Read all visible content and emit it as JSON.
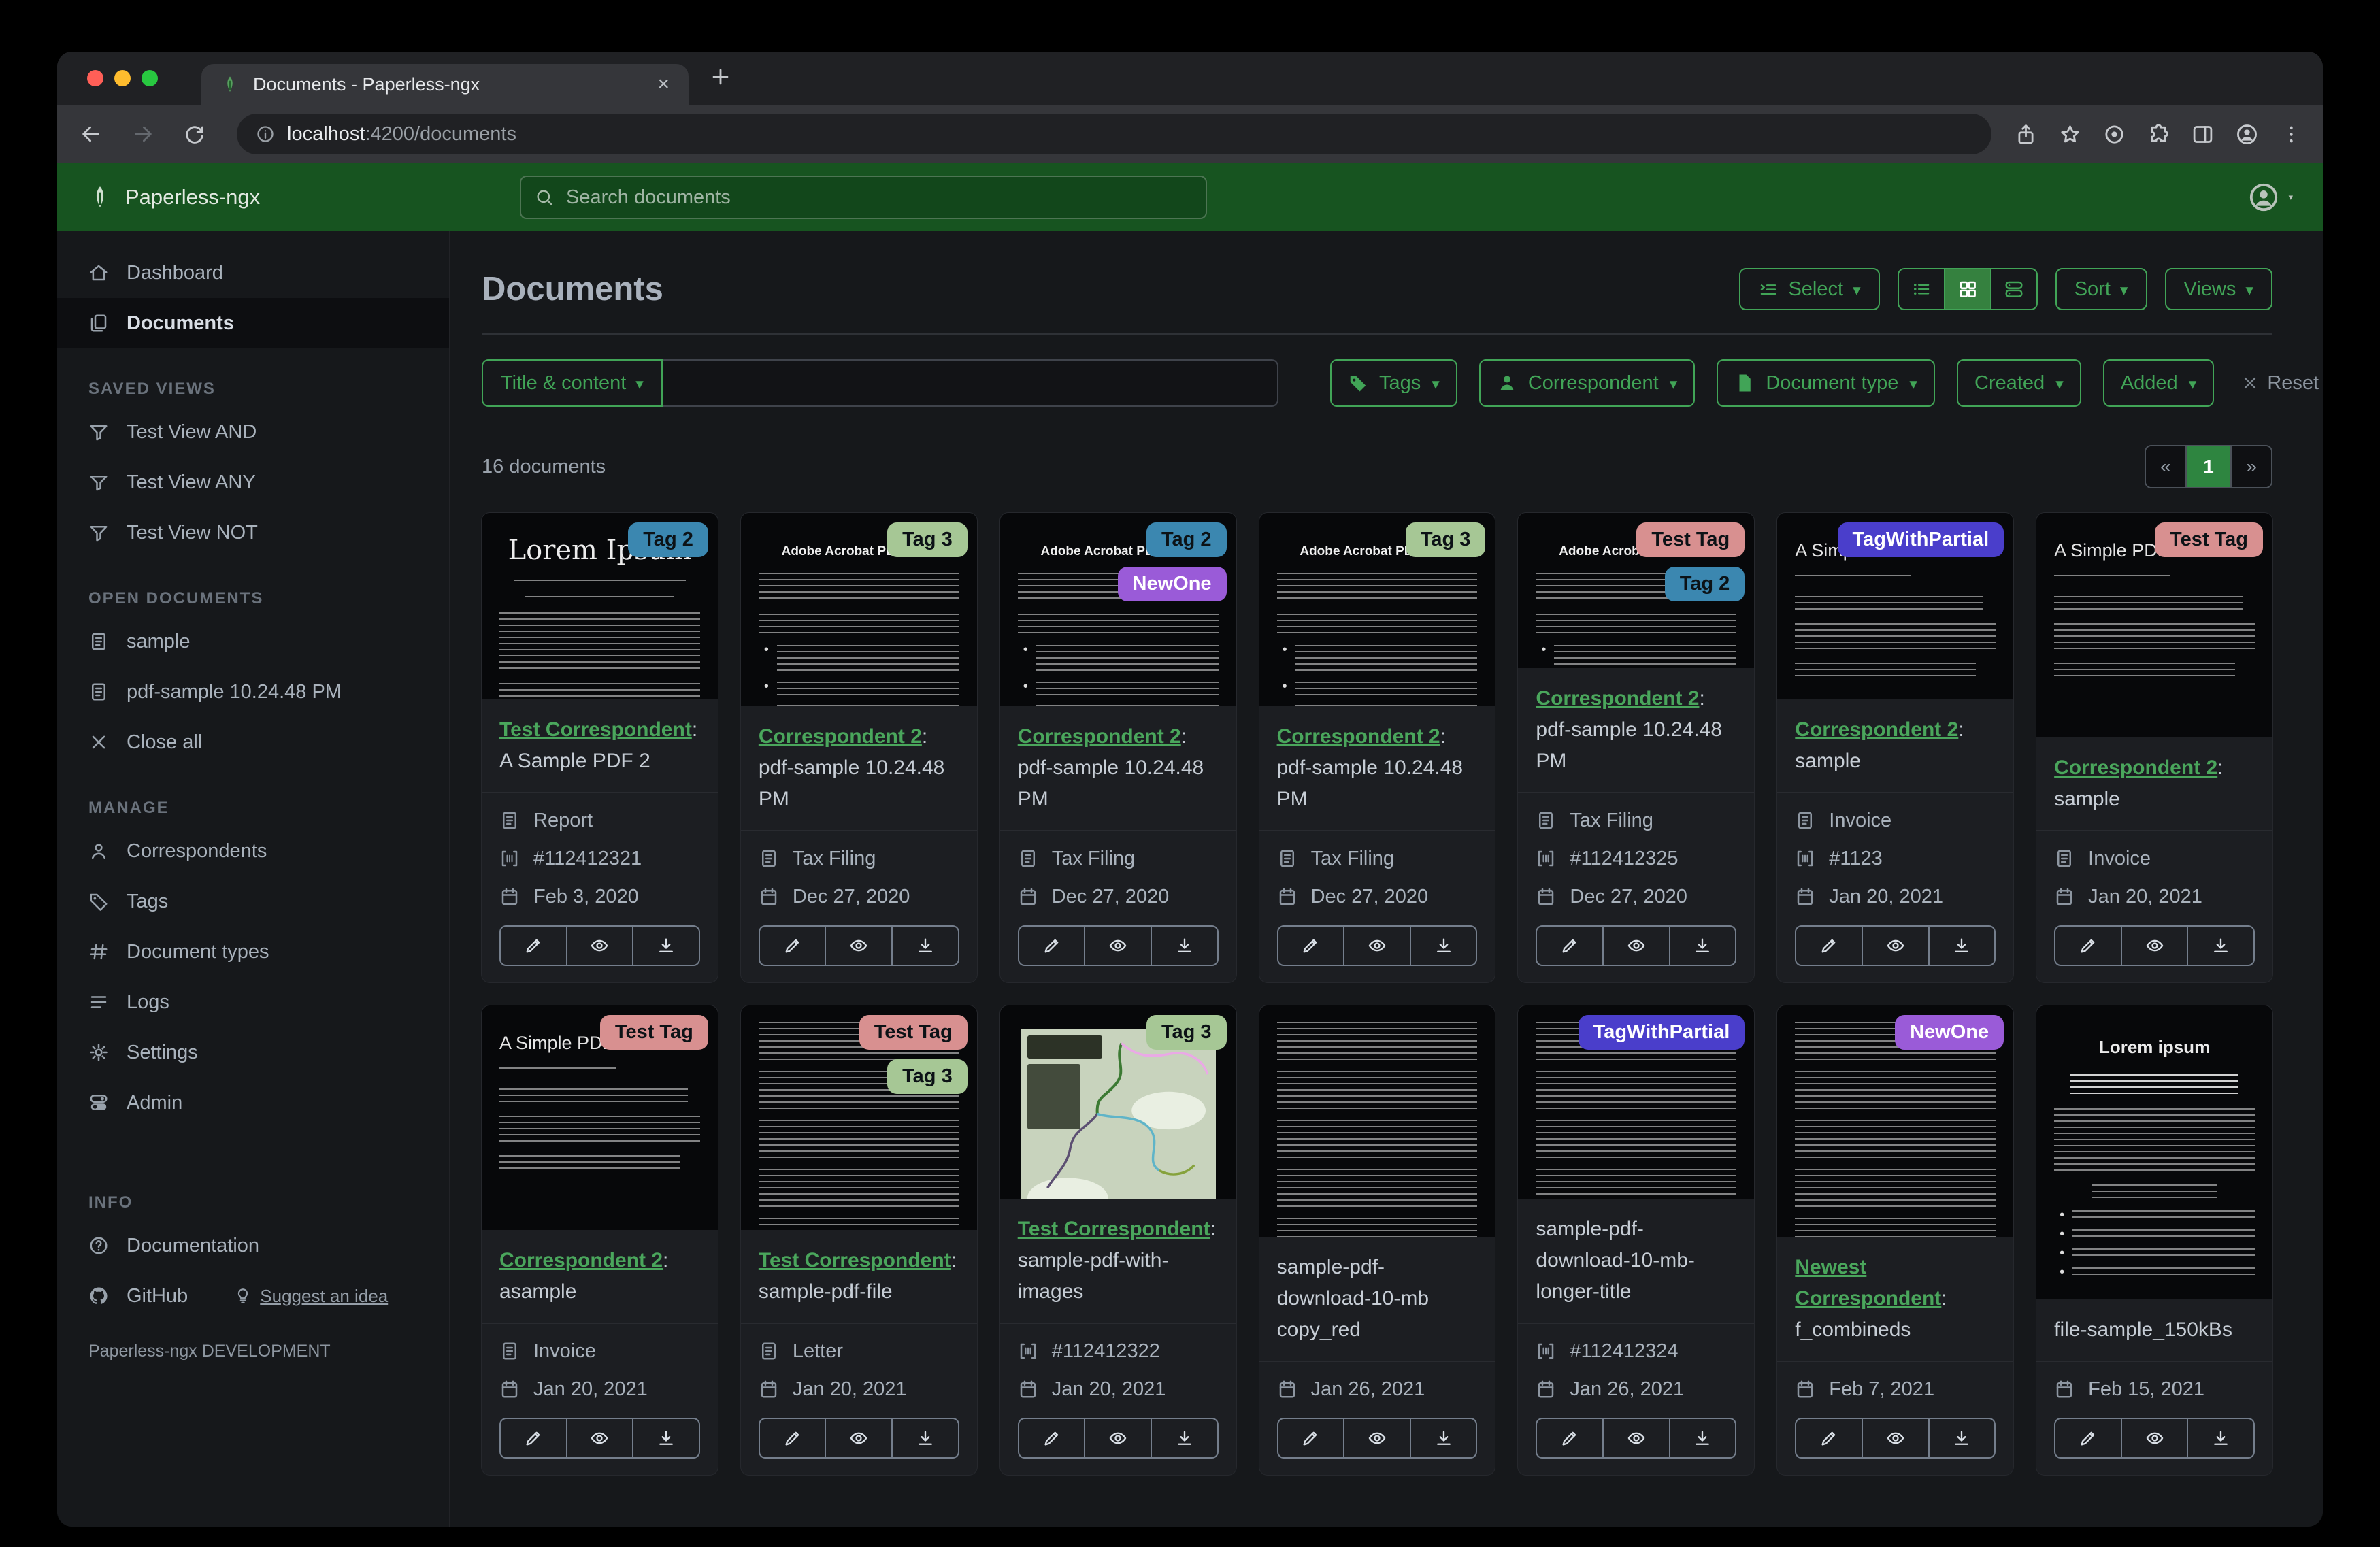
{
  "browser": {
    "tab_title": "Documents - Paperless-ngx",
    "url": {
      "host": "localhost",
      "path": ":4200/documents"
    },
    "toolbar_icons": [
      "back",
      "forward",
      "reload"
    ],
    "toolbar_right_icons": [
      "share",
      "star",
      "info",
      "puzzle",
      "side-panel",
      "profile",
      "kebab"
    ]
  },
  "appbar": {
    "brand": "Paperless-ngx",
    "brand_icon": "leaf",
    "search_icon": "search",
    "search_placeholder": "Search documents",
    "user_icon": "person-circle"
  },
  "sidebar": {
    "primary": [
      {
        "label": "Dashboard",
        "icon": "home",
        "active": false
      },
      {
        "label": "Documents",
        "icon": "documents",
        "active": true
      }
    ],
    "groups": [
      {
        "title": "SAVED VIEWS",
        "items": [
          {
            "label": "Test View AND",
            "icon": "funnel"
          },
          {
            "label": "Test View ANY",
            "icon": "funnel"
          },
          {
            "label": "Test View NOT",
            "icon": "funnel"
          }
        ]
      },
      {
        "title": "OPEN DOCUMENTS",
        "items": [
          {
            "label": "sample",
            "icon": "file-text"
          },
          {
            "label": "pdf-sample 10.24.48 PM",
            "icon": "file-text"
          },
          {
            "label": "Close all",
            "icon": "close"
          }
        ]
      },
      {
        "title": "MANAGE",
        "items": [
          {
            "label": "Correspondents",
            "icon": "person"
          },
          {
            "label": "Tags",
            "icon": "tag"
          },
          {
            "label": "Document types",
            "icon": "hash"
          },
          {
            "label": "Logs",
            "icon": "logs"
          },
          {
            "label": "Settings",
            "icon": "gear"
          },
          {
            "label": "Admin",
            "icon": "toggles"
          }
        ]
      },
      {
        "title": "INFO",
        "items": [
          {
            "label": "Documentation",
            "icon": "question"
          },
          {
            "label": "GitHub",
            "icon": "github",
            "extra": {
              "label": "Suggest an idea",
              "icon": "bulb"
            }
          }
        ]
      }
    ],
    "footer": "Paperless-ngx DEVELOPMENT"
  },
  "header": {
    "title": "Documents",
    "select_label": "Select",
    "select_icon": "select",
    "view_modes": [
      {
        "icon": "view-list",
        "active": false
      },
      {
        "icon": "view-grid",
        "active": true
      },
      {
        "icon": "view-detail",
        "active": false
      }
    ],
    "sort_label": "Sort",
    "views_label": "Views"
  },
  "filters": {
    "field_selector": "Title & content",
    "query_value": "",
    "chips": [
      {
        "label": "Tags",
        "icon": "tag-filled"
      },
      {
        "label": "Correspondent",
        "icon": "person-filled"
      },
      {
        "label": "Document type",
        "icon": "file-filled"
      },
      {
        "label": "Created",
        "icon": ""
      },
      {
        "label": "Added",
        "icon": ""
      }
    ],
    "reset_icon": "close",
    "reset_label": "Reset filters"
  },
  "results": {
    "count_label": "16 documents",
    "pagination": {
      "prev": "«",
      "page": "1",
      "next": "»"
    }
  },
  "accent_color": "#41a457",
  "navbar_color": "#175420",
  "meta_icons": {
    "type": "file-text",
    "asn": "asn",
    "created": "calendar"
  },
  "card_actions": [
    {
      "name": "edit",
      "icon": "pencil"
    },
    {
      "name": "preview",
      "icon": "eye"
    },
    {
      "name": "download",
      "icon": "download"
    }
  ],
  "tag_colors": {
    "Tag 2": {
      "bg": "#3b87b0",
      "fg": "#0c1216"
    },
    "Tag 3": {
      "bg": "#a6c795",
      "fg": "#0c1216"
    },
    "NewOne": {
      "bg": "#9a5bd8",
      "fg": "#ffffff"
    },
    "Test Tag": {
      "bg": "#d89090",
      "fg": "#0c1216"
    },
    "TagWithPartial": {
      "bg": "#4a3ecb",
      "fg": "#ffffff"
    }
  },
  "cards": [
    {
      "tags": [
        "Tag 2"
      ],
      "thumb": "lorem",
      "thumb_heading": "Lorem Ipsum",
      "correspondent": "Test Correspondent",
      "title": ": A Sample PDF 2",
      "type": "Report",
      "asn": "#112412321",
      "created": "Feb 3, 2020"
    },
    {
      "tags": [
        "Tag 3"
      ],
      "thumb": "adobe",
      "thumb_heading": "Adobe Acrobat PDF Files",
      "correspondent": "Correspondent 2",
      "title": ": pdf-sample 10.24.48 PM",
      "type": "Tax Filing",
      "created": "Dec 27, 2020"
    },
    {
      "tags": [
        "Tag 2",
        "NewOne"
      ],
      "thumb": "adobe",
      "thumb_heading": "Adobe Acrobat PDF Files",
      "correspondent": "Correspondent 2",
      "title": ": pdf-sample 10.24.48 PM",
      "type": "Tax Filing",
      "created": "Dec 27, 2020"
    },
    {
      "tags": [
        "Tag 3"
      ],
      "thumb": "adobe",
      "thumb_heading": "Adobe Acrobat PDF Files",
      "correspondent": "Correspondent 2",
      "title": ": pdf-sample 10.24.48 PM",
      "type": "Tax Filing",
      "created": "Dec 27, 2020"
    },
    {
      "tags": [
        "Test Tag",
        "Tag 2"
      ],
      "thumb": "adobe",
      "thumb_heading": "Adobe Acrobat PDF Files",
      "correspondent": "Correspondent 2",
      "title": ": pdf-sample 10.24.48 PM",
      "type": "Tax Filing",
      "asn": "#112412325",
      "created": "Dec 27, 2020"
    },
    {
      "tags": [
        "TagWithPartial"
      ],
      "thumb": "simple",
      "thumb_heading": "A Simple PDF File",
      "correspondent": "Correspondent 2",
      "title": ": sample",
      "type": "Invoice",
      "asn": "#1123",
      "created": "Jan 20, 2021"
    },
    {
      "tags": [
        "Test Tag"
      ],
      "thumb": "simple",
      "thumb_heading": "A Simple PDF File",
      "correspondent": "Correspondent 2",
      "title": ": sample",
      "type": "Invoice",
      "created": "Jan 20, 2021"
    },
    {
      "tags": [
        "Test Tag"
      ],
      "thumb": "simple",
      "thumb_heading": "A Simple PDF File",
      "correspondent": "Correspondent 2",
      "title": ": asample",
      "type": "Invoice",
      "created": "Jan 20, 2021"
    },
    {
      "tags": [
        "Test Tag",
        "Tag 3"
      ],
      "thumb": "dense",
      "thumb_heading": "",
      "correspondent": "Test Correspondent",
      "title": ": sample-pdf-file",
      "type": "Letter",
      "created": "Jan 20, 2021"
    },
    {
      "tags": [
        "Tag 3"
      ],
      "thumb": "map",
      "thumb_heading": "",
      "correspondent": "Test Correspondent",
      "title": ": sample-pdf-with-images",
      "asn": "#112412322",
      "created": "Jan 20, 2021"
    },
    {
      "tags": [],
      "thumb": "dense",
      "thumb_heading": "",
      "correspondent": null,
      "title": "sample-pdf-download-10-mb copy_red",
      "created": "Jan 26, 2021"
    },
    {
      "tags": [
        "TagWithPartial"
      ],
      "thumb": "dense",
      "thumb_heading": "",
      "correspondent": null,
      "title": "sample-pdf-download-10-mb-longer-title",
      "asn": "#112412324",
      "created": "Jan 26, 2021"
    },
    {
      "tags": [
        "NewOne"
      ],
      "thumb": "dense",
      "thumb_heading": "",
      "correspondent": "Newest Correspondent",
      "title": ": f_combineds",
      "created": "Feb 7, 2021"
    },
    {
      "tags": [],
      "thumb": "lorem2",
      "thumb_heading": "Lorem ipsum",
      "correspondent": null,
      "title": "file-sample_150kBs",
      "created": "Feb 15, 2021"
    }
  ]
}
